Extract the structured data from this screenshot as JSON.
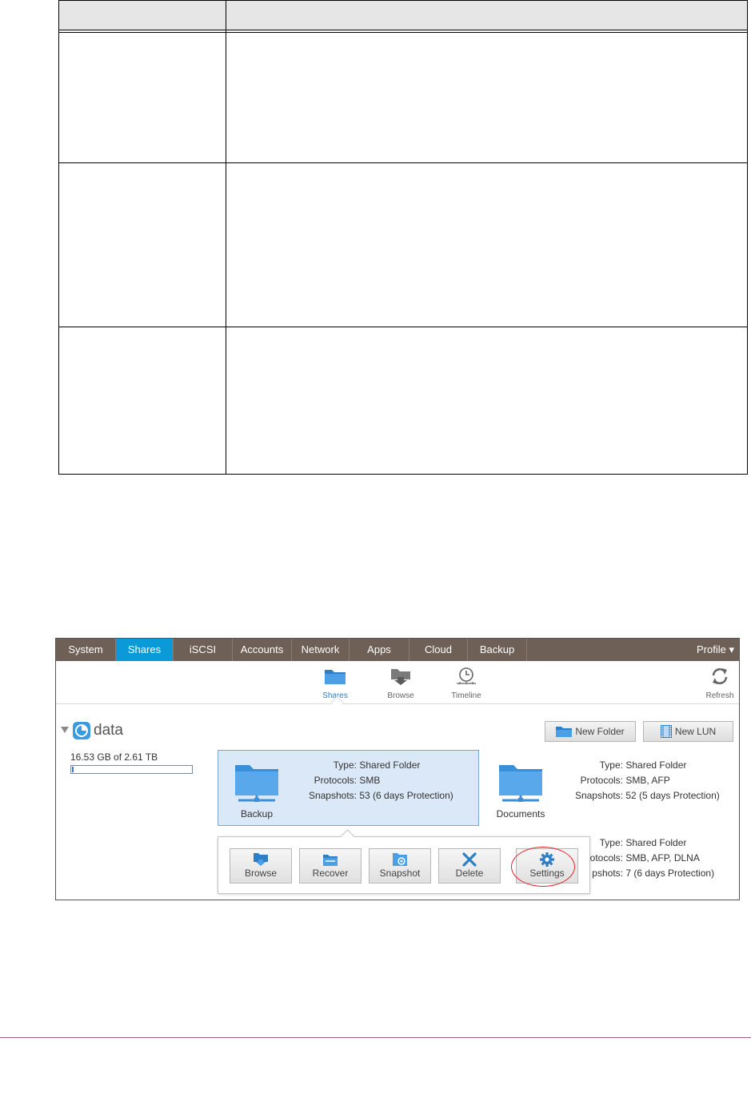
{
  "nav": {
    "tabs": [
      {
        "label": "System"
      },
      {
        "label": "Shares"
      },
      {
        "label": "iSCSI"
      },
      {
        "label": "Accounts"
      },
      {
        "label": "Network"
      },
      {
        "label": "Apps"
      },
      {
        "label": "Cloud"
      },
      {
        "label": "Backup"
      }
    ],
    "active_tab": "Shares",
    "profile_label": "Profile ▾"
  },
  "subnav": {
    "shares": "Shares",
    "browse": "Browse",
    "timeline": "Timeline",
    "refresh": "Refresh"
  },
  "volume": {
    "name": "data",
    "usage": "16.53 GB of 2.61 TB",
    "usage_fraction": 0.006
  },
  "actions": {
    "new_folder": "New Folder",
    "new_lun": "New LUN"
  },
  "shares": [
    {
      "name": "Backup",
      "type_key": "Type:",
      "type": "Shared Folder",
      "protocols_key": "Protocols:",
      "protocols": "SMB",
      "snapshots_key": "Snapshots:",
      "snapshots": "53 (6 days Protection)"
    },
    {
      "name": "Documents",
      "type_key": "Type:",
      "type": "Shared Folder",
      "protocols_key": "Protocols:",
      "protocols": "SMB, AFP",
      "snapshots_key": "Snapshots:",
      "snapshots": "52 (5 days Protection)"
    },
    {
      "type_key": "Type:",
      "type": "Shared Folder",
      "protocols_key": "otocols:",
      "protocols": "SMB, AFP, DLNA",
      "snapshots_key": "pshots:",
      "snapshots": "7 (6 days Protection)"
    }
  ],
  "popup": {
    "browse": "Browse",
    "recover": "Recover",
    "snapshot": "Snapshot",
    "delete": "Delete",
    "settings": "Settings"
  },
  "colors": {
    "nav_bg": "#6e5f57",
    "nav_active": "#0a9ad7",
    "folder_blue": "#4a9fe6",
    "highlight_ring": "#e0262b",
    "footer_rule": "#a15b8c"
  }
}
